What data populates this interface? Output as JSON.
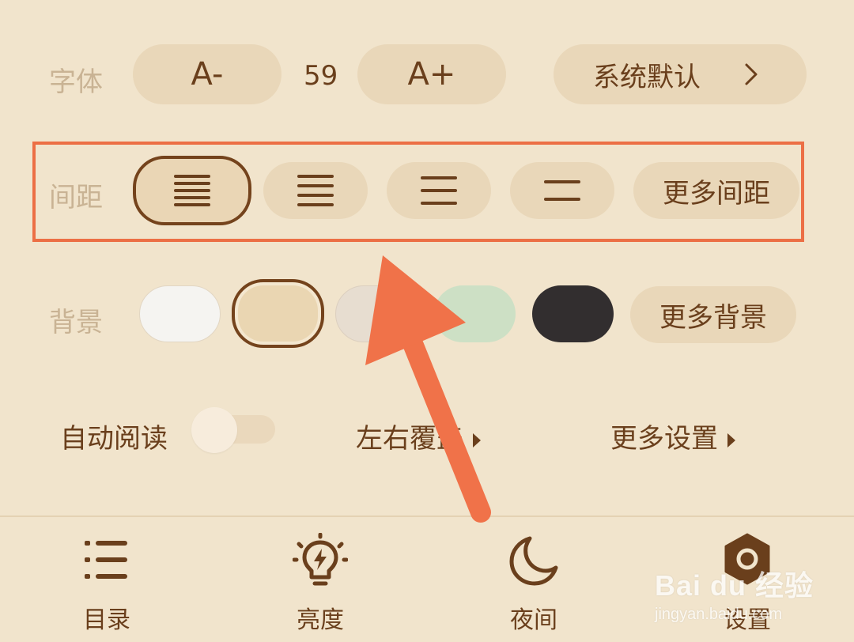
{
  "font_row": {
    "label": "字体",
    "decrease_label": "A-",
    "size_value": "59",
    "increase_label": "A+",
    "typeface_label": "系统默认",
    "chevron_icon": "chevron-right-icon"
  },
  "spacing_row": {
    "label": "间距",
    "options": [
      {
        "icon": "spacing-dense-icon"
      },
      {
        "icon": "spacing-compact-icon"
      },
      {
        "icon": "spacing-medium-icon"
      },
      {
        "icon": "spacing-loose-icon"
      }
    ],
    "selected_index": 0,
    "more_label": "更多间距",
    "highlight_color": "#ec6f45"
  },
  "background_row": {
    "label": "背景",
    "swatches": [
      "#f5f4f1",
      "#ecdab8",
      "#e7ddd0",
      "#cde0c5",
      "#322e2f"
    ],
    "selected_index": 1,
    "more_label": "更多背景"
  },
  "options_row": {
    "auto_read_label": "自动阅读",
    "auto_read_on": false,
    "page_turn_label": "左右覆盖",
    "more_settings_label": "更多设置"
  },
  "bottom_nav": [
    {
      "label": "目录",
      "icon": "list-icon"
    },
    {
      "label": "亮度",
      "icon": "lightbulb-icon"
    },
    {
      "label": "夜间",
      "icon": "moon-icon"
    },
    {
      "label": "设置",
      "icon": "settings-icon"
    }
  ],
  "watermark": {
    "brand": "Bai du 经验",
    "url": "jingyan.baidu.com"
  },
  "colors": {
    "background": "#f1e4cc",
    "text": "#6a3f1c",
    "accent_arrow": "#f07249"
  }
}
